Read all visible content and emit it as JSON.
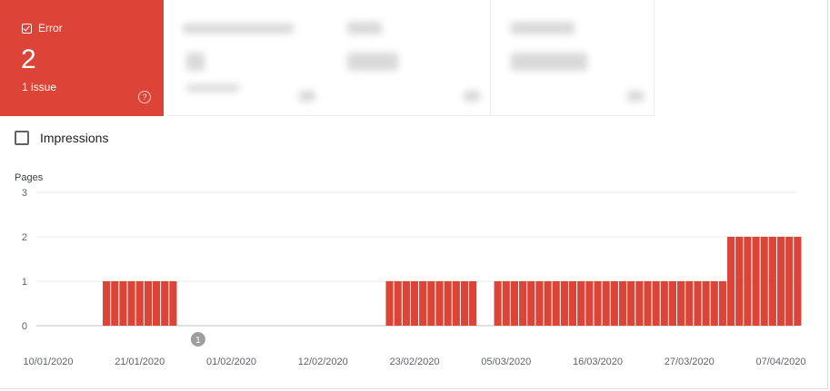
{
  "summary": {
    "error_label": "Error",
    "error_count": "2",
    "error_issues": "1 issue",
    "help_icon": "?"
  },
  "toggle": {
    "impressions_label": "Impressions"
  },
  "colors": {
    "error": "#db4437",
    "grid": "#e8eaed",
    "axis": "#bdc1c6"
  },
  "annotation": {
    "label": "1"
  },
  "chart_data": {
    "type": "bar",
    "ylabel": "Pages",
    "ylim": [
      0,
      3
    ],
    "yticks": [
      "0",
      "1",
      "2",
      "3"
    ],
    "xtick_labels": [
      "10/01/2020",
      "21/01/2020",
      "01/02/2020",
      "12/02/2020",
      "23/02/2020",
      "05/03/2020",
      "16/03/2020",
      "27/03/2020",
      "07/04/2020"
    ],
    "x_start": "10/01/2020",
    "x_end": "07/04/2020",
    "segments": [
      {
        "from": "17/01/2020",
        "to": "25/01/2020",
        "value": 1
      },
      {
        "from": "20/02/2020",
        "to": "01/03/2020",
        "value": 1
      },
      {
        "from": "04/03/2020",
        "to": "31/03/2020",
        "value": 1
      },
      {
        "from": "01/04/2020",
        "to": "09/04/2020",
        "value": 2
      }
    ],
    "annotations": [
      {
        "date": "28/01/2020",
        "label": "1"
      }
    ],
    "grid": true
  }
}
